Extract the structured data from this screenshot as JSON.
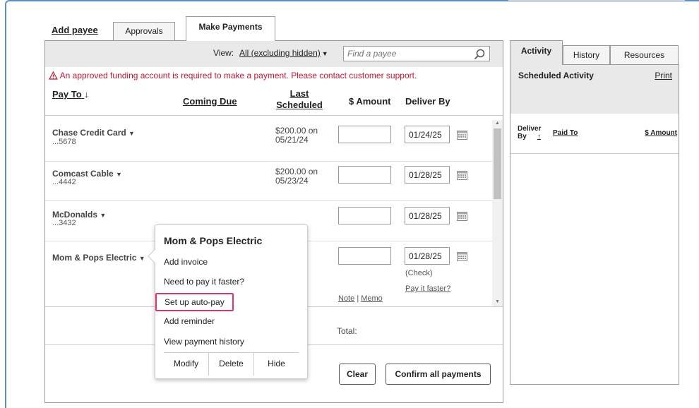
{
  "tabs": {
    "add_payee": "Add payee",
    "approvals": "Approvals",
    "make_payments": "Make Payments"
  },
  "view": {
    "label": "View:",
    "selected": "All (excluding hidden)",
    "search_placeholder": "Find a payee"
  },
  "warning": "An approved funding account is required to make a payment. Please contact customer support.",
  "columns": {
    "pay_to": "Pay To",
    "coming_due": "Coming Due",
    "last_scheduled": "Last Scheduled",
    "amount": "$ Amount",
    "deliver_by": "Deliver By"
  },
  "payees": [
    {
      "name": "Chase Credit Card",
      "account": "...5678",
      "last_scheduled": "$200.00 on\n05/21/24",
      "deliver_by": "01/24/25"
    },
    {
      "name": "Comcast Cable",
      "account": "...4442",
      "last_scheduled": "$200.00 on\n05/23/24",
      "deliver_by": "01/28/25"
    },
    {
      "name": "McDonalds",
      "account": "...3432",
      "last_scheduled": "",
      "deliver_by": "01/28/25"
    },
    {
      "name": "Mom & Pops Electric",
      "account": "",
      "last_scheduled": "",
      "deliver_by": "01/28/25",
      "method": "(Check)",
      "pay_faster": "Pay it faster?"
    }
  ],
  "note_memo": {
    "note": "Note",
    "separator": "|",
    "memo": "Memo"
  },
  "total_label": "Total:",
  "buttons": {
    "clear": "Clear",
    "confirm": "Confirm all payments"
  },
  "popup": {
    "title": "Mom & Pops Electric",
    "items": [
      "Add invoice",
      "Need to pay it faster?",
      "Set up auto-pay",
      "Add reminder",
      "View payment history"
    ],
    "actions": [
      "Modify",
      "Delete",
      "Hide"
    ]
  },
  "right_panel": {
    "tabs": [
      "Activity",
      "History",
      "Resources"
    ],
    "title": "Scheduled Activity",
    "print": "Print",
    "col_deliver": "Deliver By",
    "col_paid_to": "Paid To",
    "col_amount": "$ Amount"
  },
  "colors": {
    "accent_blue": "#5b8ec9",
    "warning_red": "#c0152f",
    "highlight_pink": "#d93a6a"
  }
}
